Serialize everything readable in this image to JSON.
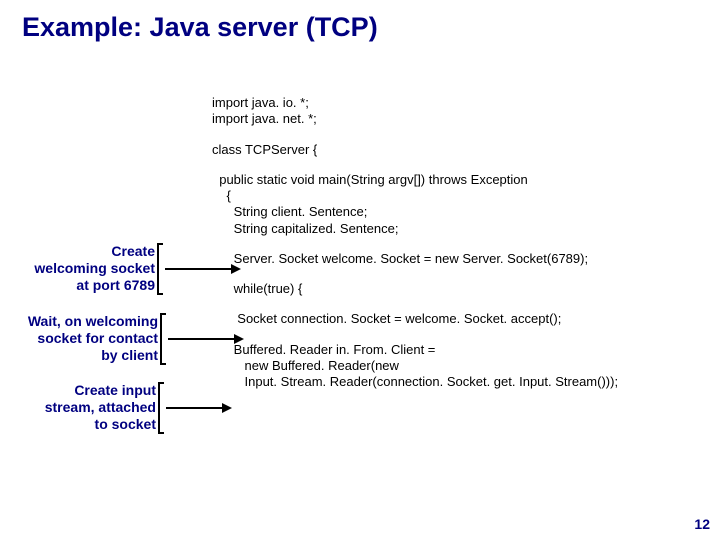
{
  "title": "Example: Java server (TCP)",
  "code": {
    "l1": "import java. io. *;",
    "l2": "import java. net. *;",
    "l3": "class TCPServer {",
    "l4": "  public static void main(String argv[]) throws Exception",
    "l5": "    {",
    "l6": "      String client. Sentence;",
    "l7": "      String capitalized. Sentence;",
    "l8": "      Server. Socket welcome. Socket = new Server. Socket(6789);",
    "l9": "      while(true) {",
    "l10": "       Socket connection. Socket = welcome. Socket. accept();",
    "l11": "      Buffered. Reader in. From. Client =",
    "l12": "         new Buffered. Reader(new",
    "l13": "         Input. Stream. Reader(connection. Socket. get. Input. Stream()));"
  },
  "annotations": {
    "a1_l1": "Create",
    "a1_l2": "welcoming socket",
    "a1_l3": "at port 6789",
    "a2_l1": "Wait, on welcoming",
    "a2_l2": "socket for contact",
    "a2_l3": "by client",
    "a3_l1": "Create input",
    "a3_l2": "stream, attached",
    "a3_l3": "to socket"
  },
  "corner": "12"
}
